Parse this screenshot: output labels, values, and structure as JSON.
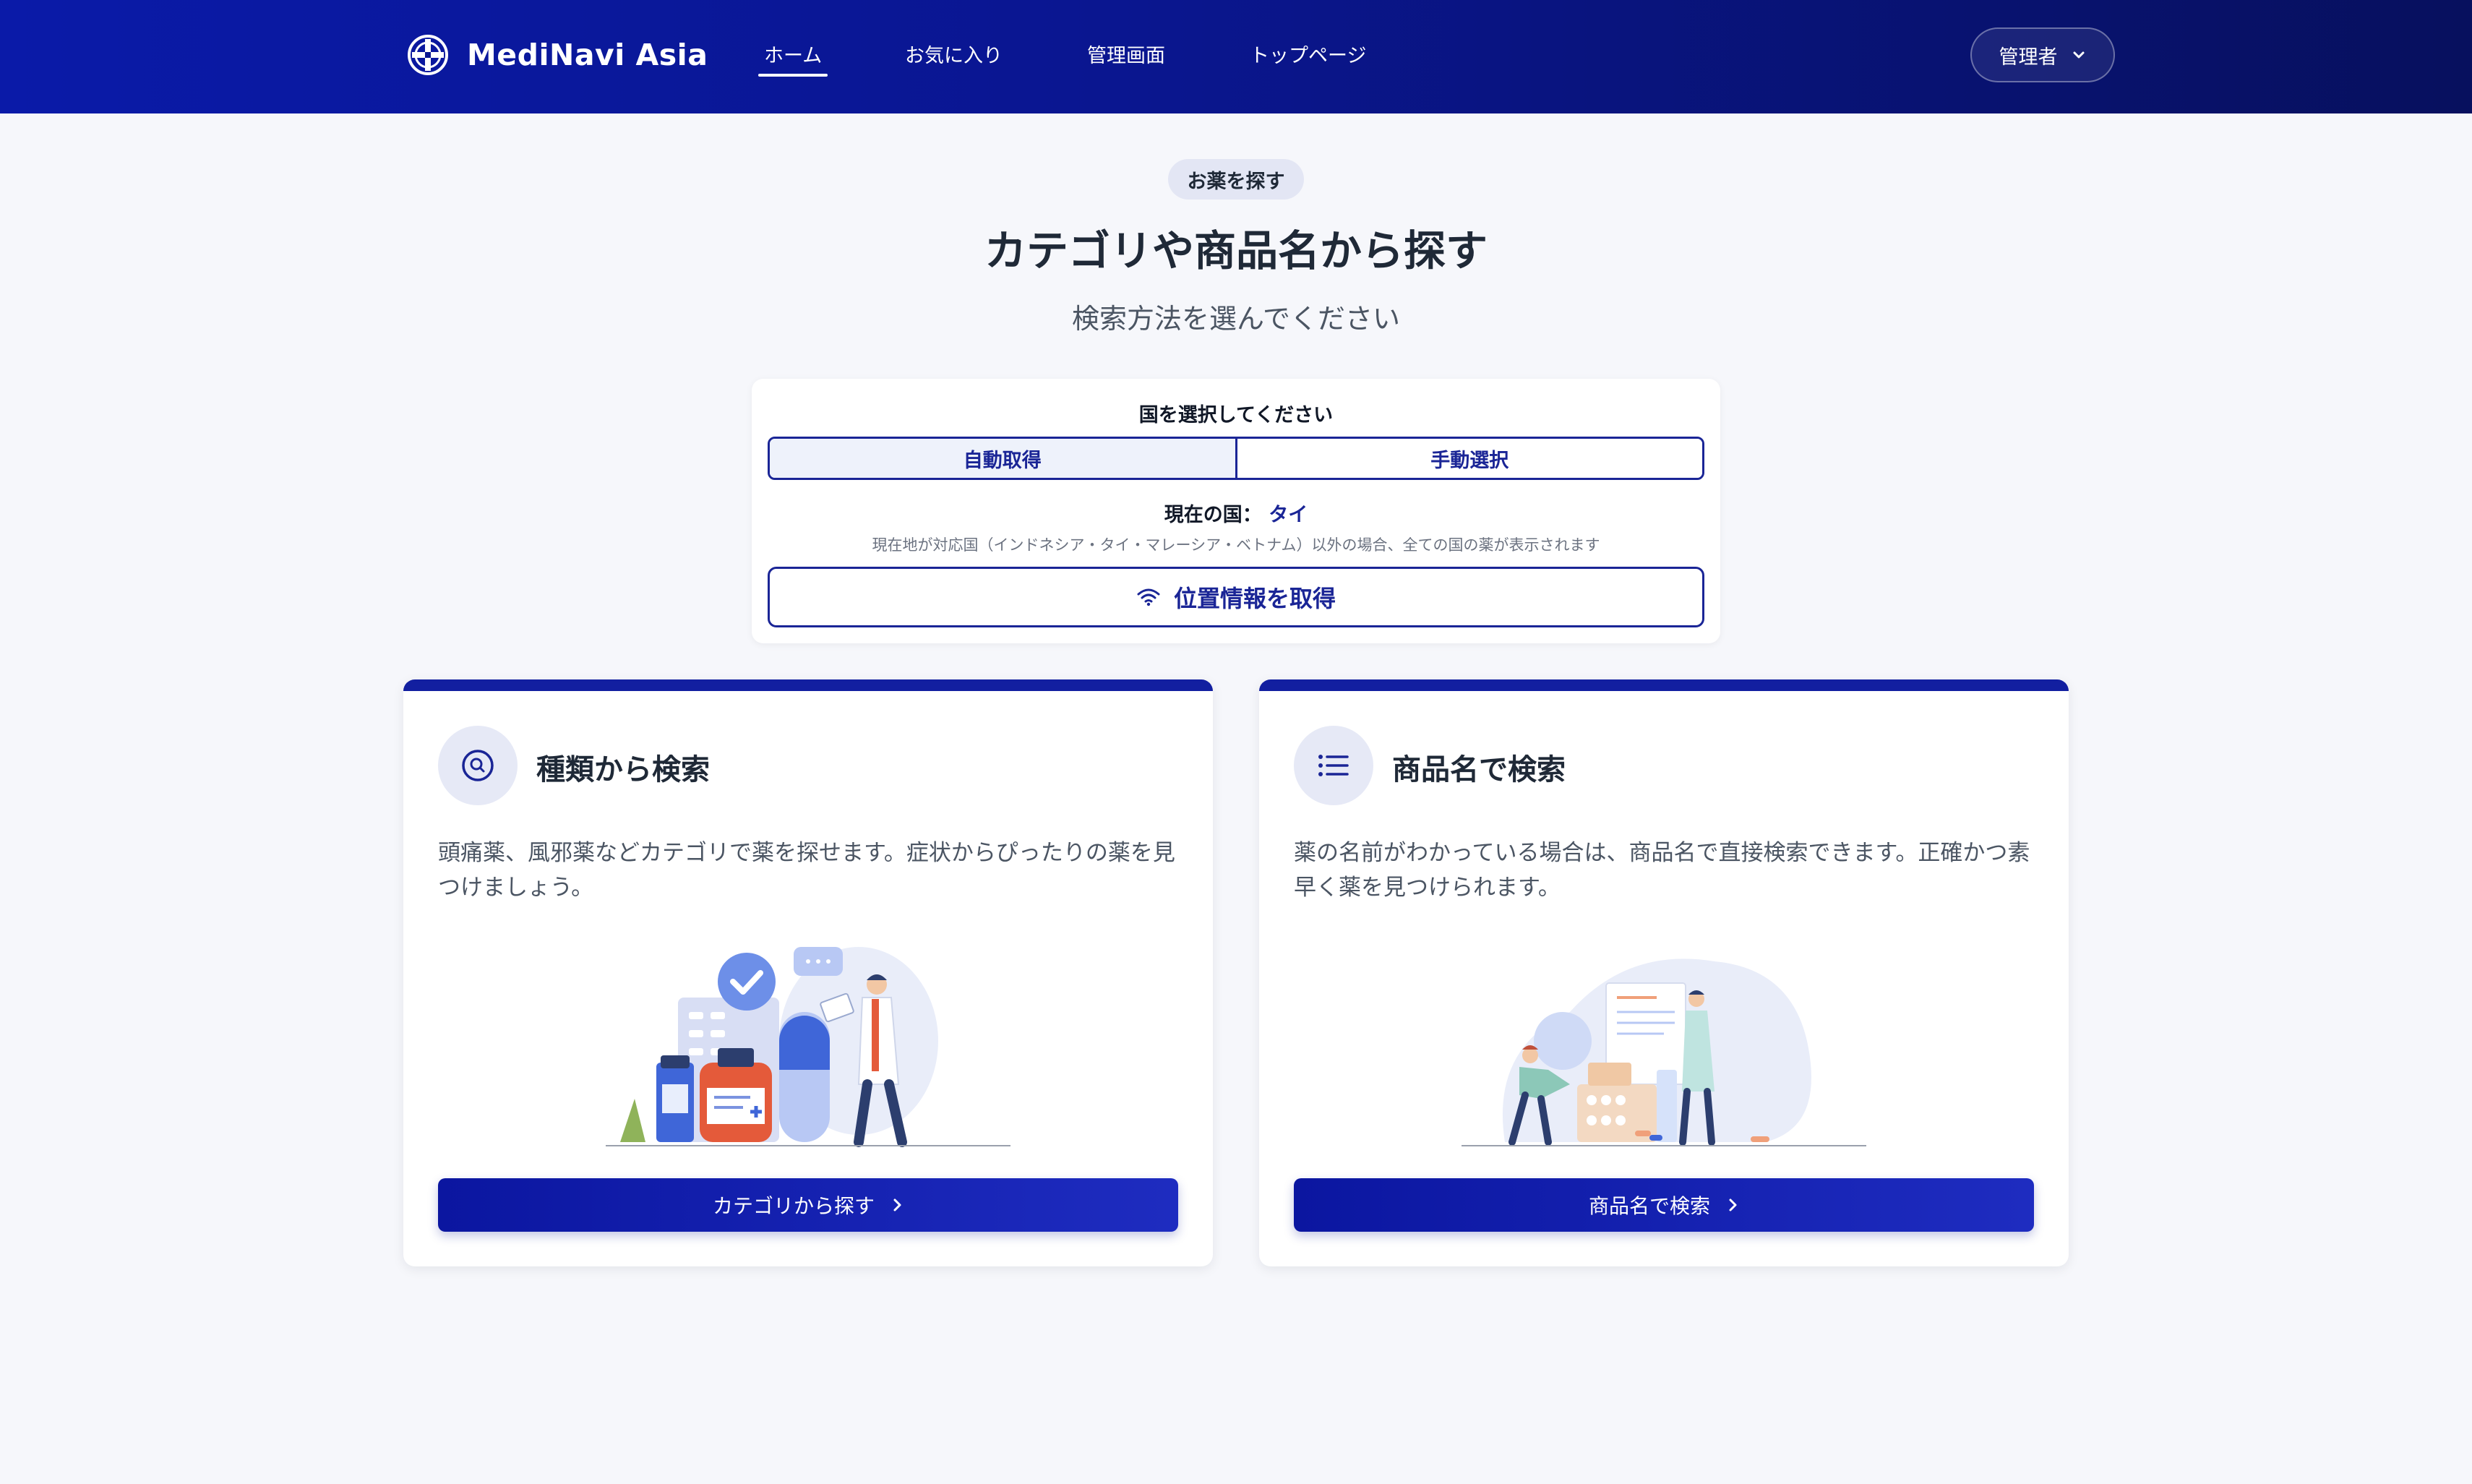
{
  "header": {
    "brand": "MediNavi Asia",
    "nav": [
      {
        "label": "ホーム",
        "active": true
      },
      {
        "label": "お気に入り",
        "active": false
      },
      {
        "label": "管理画面",
        "active": false
      },
      {
        "label": "トップページ",
        "active": false
      }
    ],
    "admin_label": "管理者"
  },
  "hero": {
    "pill": "お薬を探す",
    "title": "カテゴリや商品名から探す",
    "subtitle": "検索方法を選んでください"
  },
  "country": {
    "label": "国を選択してください",
    "modes": [
      {
        "label": "自動取得",
        "active": true
      },
      {
        "label": "手動選択",
        "active": false
      }
    ],
    "current_label": "現在の国：",
    "current_value": "タイ",
    "note": "現在地が対応国（インドネシア・タイ・マレーシア・ベトナム）以外の場合、全ての国の薬が表示されます",
    "location_button": "位置情報を取得"
  },
  "cards": [
    {
      "title": "種類から検索",
      "description": "頭痛薬、風邪薬などカテゴリで薬を探せます。症状からぴったりの薬を見つけましょう。",
      "button": "カテゴリから探す",
      "icon": "search-icon"
    },
    {
      "title": "商品名で検索",
      "description": "薬の名前がわかっている場合は、商品名で直接検索できます。正確かつ素早く薬を見つけられます。",
      "button": "商品名で検索",
      "icon": "list-icon"
    }
  ],
  "colors": {
    "primary": "#121fa0",
    "header_start": "#0a1aa8",
    "header_end": "#07105e",
    "background": "#f6f7fb"
  }
}
